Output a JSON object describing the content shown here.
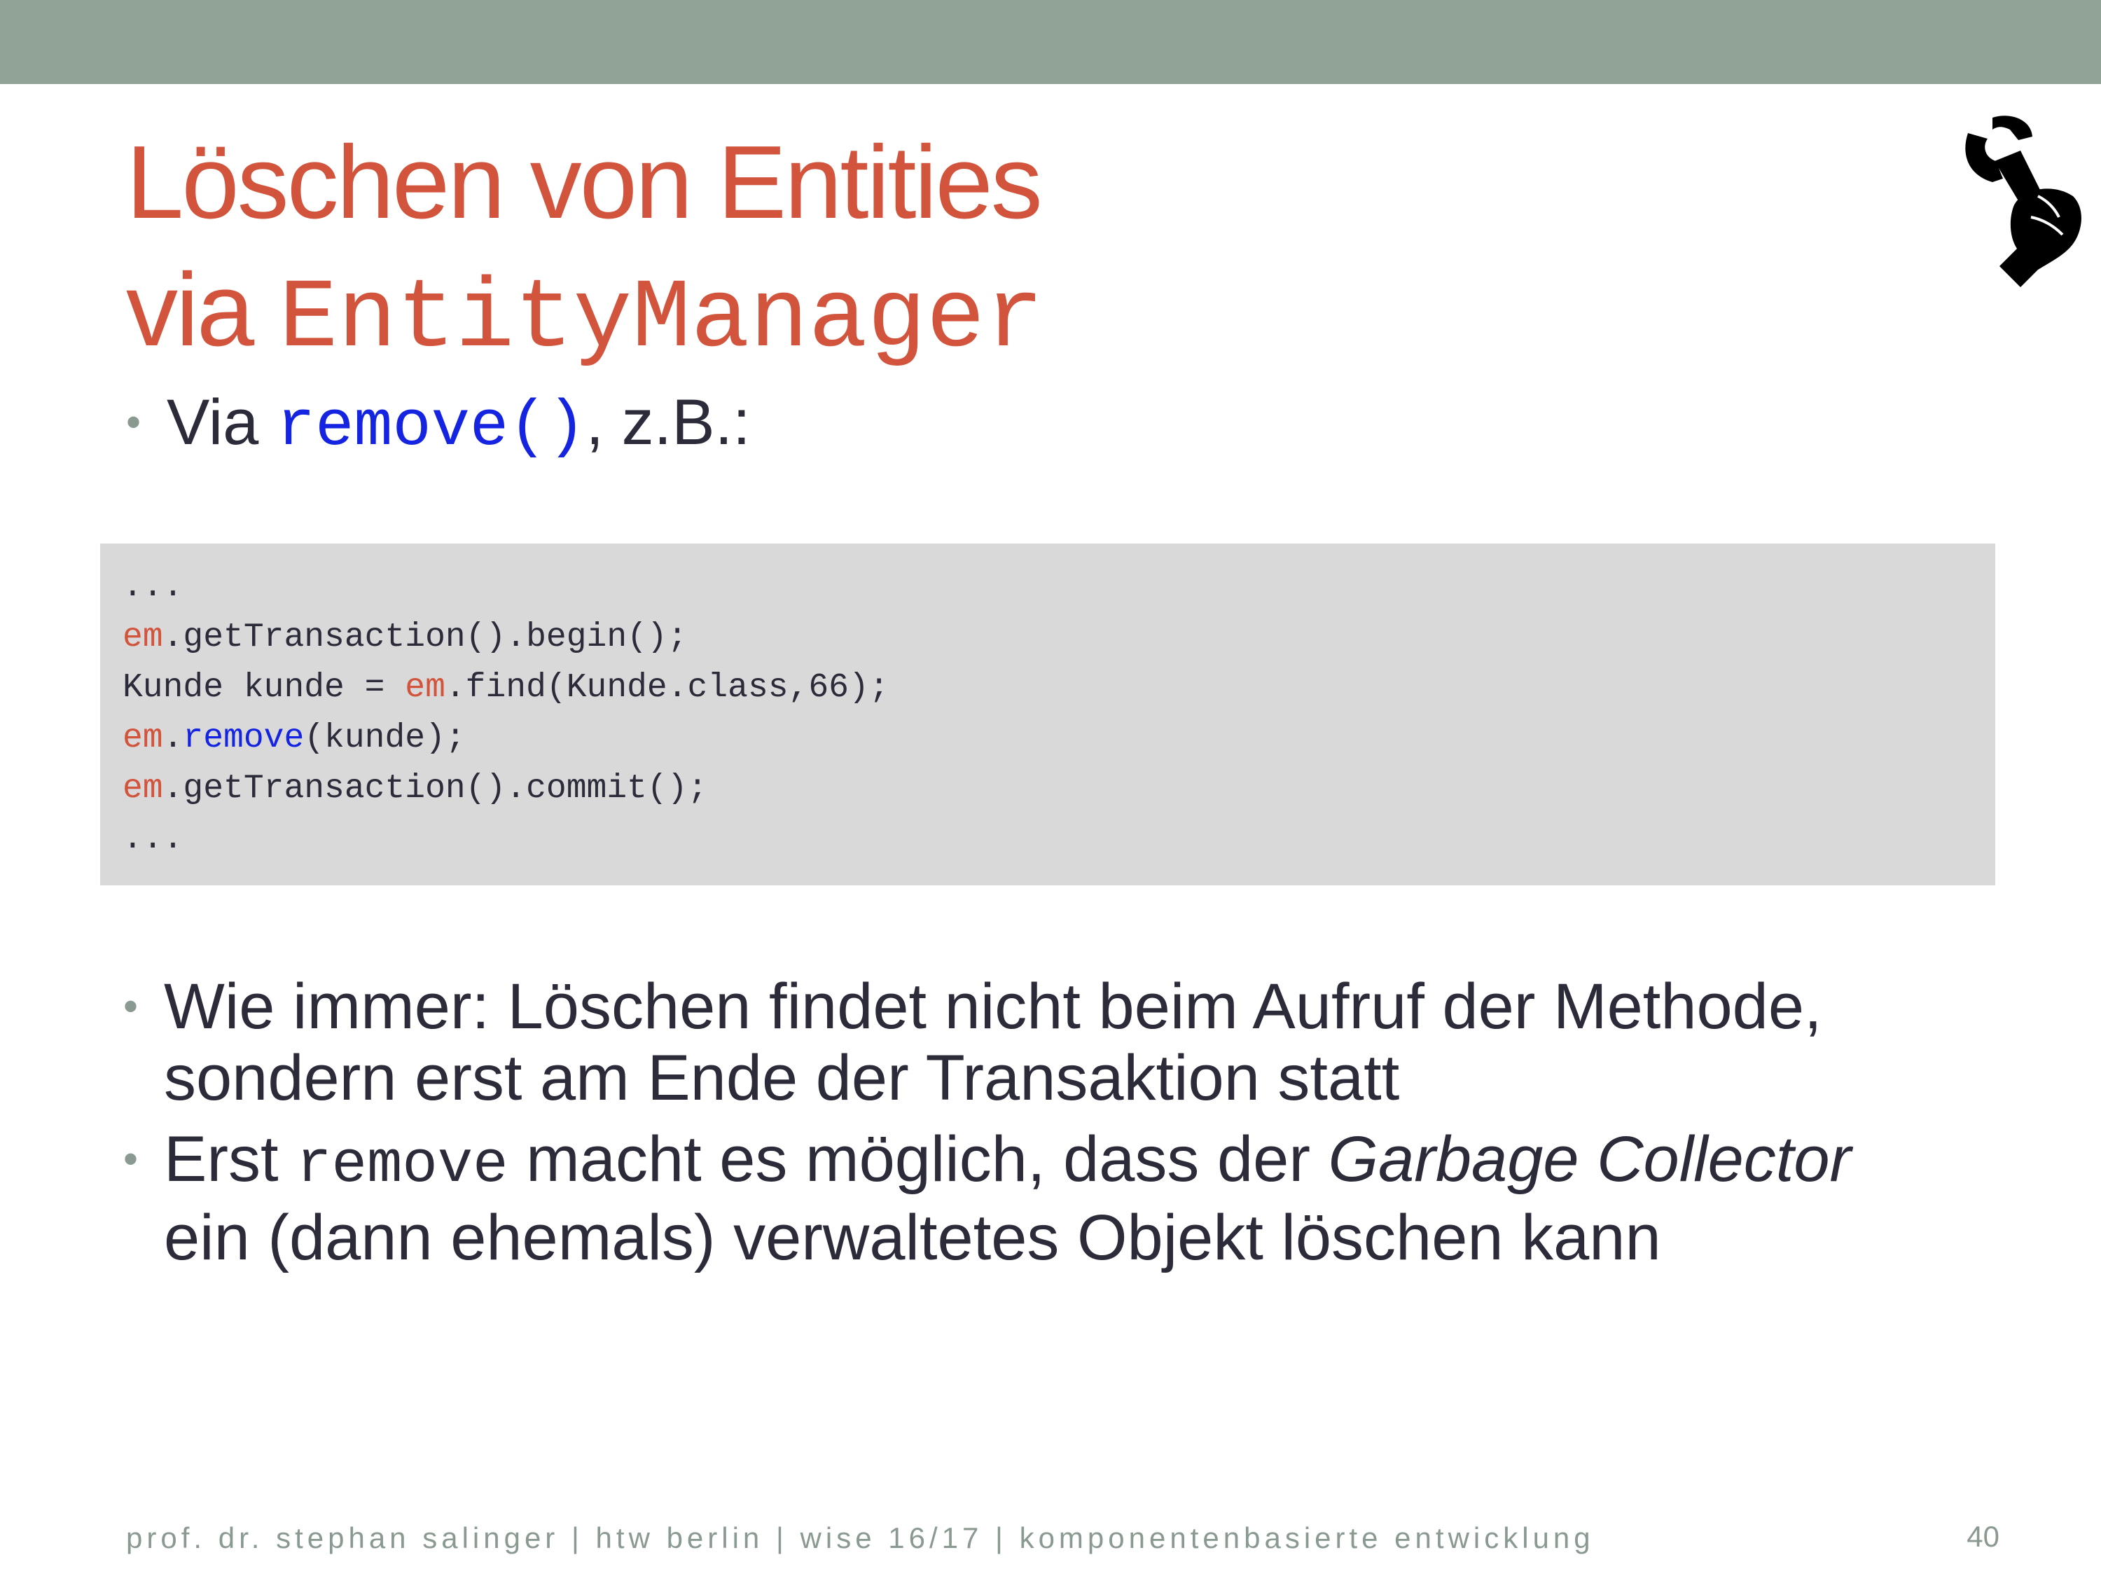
{
  "slide": {
    "title_line1": "Löschen von Entities",
    "title_line2_prefix": "via",
    "title_line2_code": "EntityManager"
  },
  "bullets": {
    "b1_prefix": "Via",
    "b1_code": "remove()",
    "b1_suffix": ", z.B.:",
    "b2_text": "Wie immer: Löschen findet nicht beim Aufruf der Methode, sondern erst am Ende der Transaktion statt",
    "b3_part1": "Erst",
    "b3_code": "remove",
    "b3_part2": "macht es möglich, dass der",
    "b3_italic": "Garbage Collector",
    "b3_part3": "ein (dann ehemals) verwaltetes Objekt löschen kann"
  },
  "code": {
    "line1": "...",
    "line2_em": "em",
    "line2_rest": ".getTransaction().begin();",
    "line3_a": "Kunde kunde = ",
    "line3_em": "em",
    "line3_rest": ".find(Kunde.class,66);",
    "line4_em": "em",
    "line4_dot": ".",
    "line4_kw": "remove",
    "line4_rest": "(kunde);",
    "line5_em": "em",
    "line5_rest": ".getTransaction().commit();",
    "line6": "..."
  },
  "footer": {
    "text": "prof. dr. stephan salinger | htw berlin | wise 16/17 | komponentenbasierte entwicklung",
    "page_number": "40"
  },
  "colors": {
    "accent": "#d2543c",
    "code_keyword": "#1424e0",
    "top_bar": "#91a297",
    "code_background": "#d9d9d9"
  },
  "icons": [
    "wrench-in-hand-icon"
  ]
}
